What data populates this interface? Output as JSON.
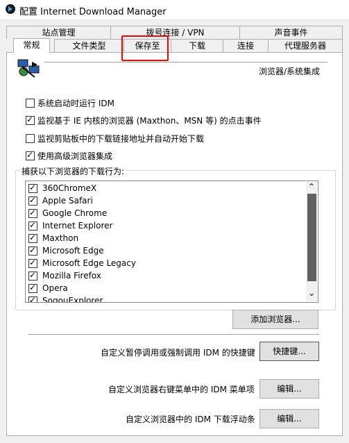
{
  "window": {
    "title": "配置 Internet Download Manager"
  },
  "tabs_row1": [
    "站点管理",
    "拨号连接 / VPN",
    "声音事件"
  ],
  "tabs_row2": [
    "常规",
    "文件类型",
    "保存至",
    "下载",
    "连接",
    "代理服务器"
  ],
  "section_title": "浏览器/系统集成",
  "options": [
    {
      "label": "系统启动时运行 IDM",
      "checked": false
    },
    {
      "label": "监视基于 IE 内核的浏览器 (Maxthon、MSN 等) 的点击事件",
      "checked": true
    },
    {
      "label": "监视剪贴板中的下载链接地址并自动开始下载",
      "checked": false
    },
    {
      "label": "使用高级浏览器集成",
      "checked": true
    }
  ],
  "browsers_group_label": "捕获以下浏览器的下载行为:",
  "browsers": [
    {
      "label": "360ChromeX",
      "checked": true
    },
    {
      "label": "Apple Safari",
      "checked": true
    },
    {
      "label": "Google Chrome",
      "checked": true
    },
    {
      "label": "Internet Explorer",
      "checked": true
    },
    {
      "label": "Maxthon",
      "checked": true
    },
    {
      "label": "Microsoft Edge",
      "checked": true
    },
    {
      "label": "Microsoft Edge Legacy",
      "checked": true
    },
    {
      "label": "Mozilla Firefox",
      "checked": true
    },
    {
      "label": "Opera",
      "checked": true
    },
    {
      "label": "SogouExplorer",
      "checked": true
    }
  ],
  "add_browser_button": "添加浏览器...",
  "hotkey_row": {
    "label": "自定义暂停调用或强制调用 IDM 的快捷键",
    "button": "快捷键..."
  },
  "context_menu_row": {
    "label": "自定义浏览器右键菜单中的 IDM 菜单项",
    "button": "编辑..."
  },
  "float_bar_row": {
    "label": "自定义浏览器中的 IDM 下载浮动条",
    "button": "编辑..."
  },
  "scroll_up_glyph": "⌃",
  "scroll_down_glyph": "⌄"
}
